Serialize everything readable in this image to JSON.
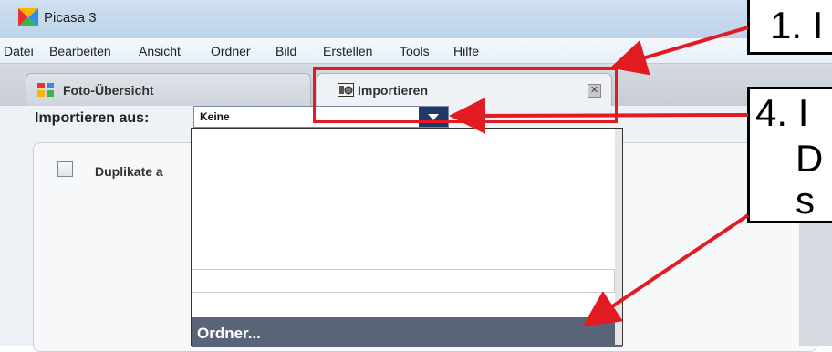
{
  "app": {
    "title": "Picasa 3"
  },
  "menu": [
    "Datei",
    "Bearbeiten",
    "Ansicht",
    "Ordner",
    "Bild",
    "Erstellen",
    "Tools",
    "Hilfe"
  ],
  "tabs": {
    "overview": {
      "label": "Foto-Übersicht"
    },
    "import": {
      "label": "Importieren",
      "close_icon": "close-icon"
    }
  },
  "import": {
    "source_label": "Importieren aus:",
    "source_value": "Keine",
    "duplicates_label": "Duplikate a",
    "duplicates_checked": false
  },
  "dropdown": {
    "selected_option": "Ordner..."
  },
  "callouts": {
    "c1": {
      "text": "1. I"
    },
    "c4_line1": "4. I",
    "c4_line2": "D",
    "c4_line3": "s"
  },
  "colors": {
    "highlight": "#e21b23",
    "dropdown_button": "#1f3a66",
    "selected_row": "#5a6478"
  }
}
